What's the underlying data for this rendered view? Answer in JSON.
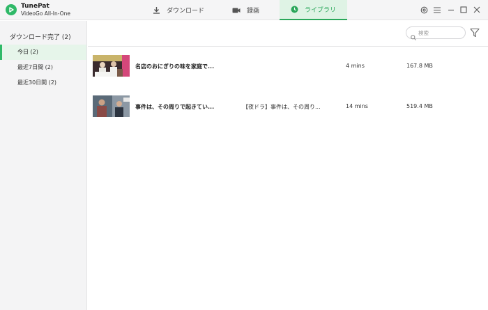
{
  "app": {
    "name": "TunePat",
    "subtitle": "VideoGo All-In-One"
  },
  "tabs": {
    "download": "ダウンロード",
    "record": "録画",
    "library": "ライブラリ"
  },
  "window_controls": [
    "settings-icon",
    "menu-icon",
    "minimize-icon",
    "maximize-icon",
    "close-icon"
  ],
  "sidebar": {
    "header": "ダウンロード完了 (2)",
    "items": [
      {
        "label": "今日 (2)",
        "active": true
      },
      {
        "label": "最近7日間 (2)",
        "active": false
      },
      {
        "label": "最近30日間 (2)",
        "active": false
      }
    ]
  },
  "toolbar": {
    "search_placeholder": "検索"
  },
  "rows": [
    {
      "title": "名店のおにぎりの味を家庭で...",
      "description": "",
      "duration": "4 mins",
      "size": "167.8 MB"
    },
    {
      "title": "事件は、その周りで起きてい...",
      "description": "【夜ドラ】事件は、その周り...",
      "duration": "14 mins",
      "size": "519.4 MB"
    }
  ],
  "colors": {
    "accent": "#2fb968",
    "tab_active_bg": "#dff3e5",
    "sidebar_bg": "#f4f4f5"
  }
}
